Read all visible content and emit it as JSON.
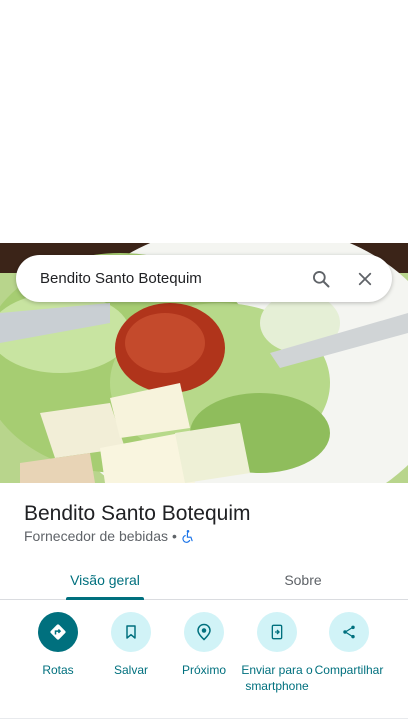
{
  "search": {
    "query": "Bendito Santo Botequim"
  },
  "place": {
    "name": "Bendito Santo Botequim",
    "category": "Fornecedor de bebidas",
    "separator": "•"
  },
  "tabs": [
    {
      "label": "Visão geral",
      "active": true
    },
    {
      "label": "Sobre",
      "active": false
    }
  ],
  "actions": [
    {
      "label": "Rotas",
      "icon": "directions-icon"
    },
    {
      "label": "Salvar",
      "icon": "bookmark-icon"
    },
    {
      "label": "Próximo",
      "icon": "nearby-icon"
    },
    {
      "label": "Enviar para o smartphone",
      "icon": "send-to-phone-icon"
    },
    {
      "label": "Compartilhar",
      "icon": "share-icon"
    }
  ],
  "colors": {
    "accent": "#00707e",
    "chip": "#d1f3f7",
    "accessibility": "#1a73e8"
  }
}
